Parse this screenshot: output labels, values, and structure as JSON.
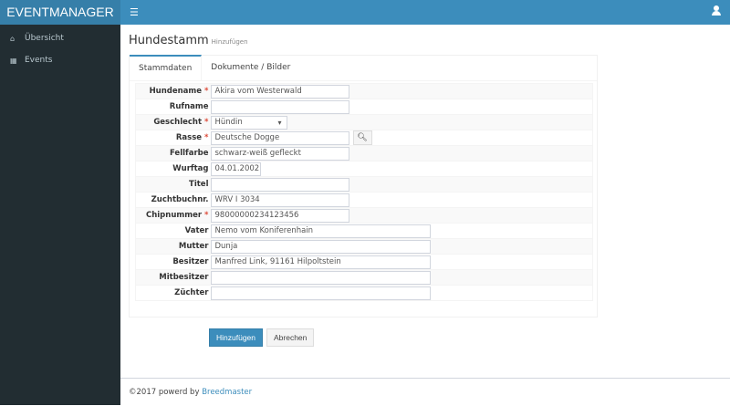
{
  "app": {
    "brand": "EVENTMANAGER",
    "menu_icon": "bars-icon",
    "user_icon": "user-icon"
  },
  "sidebar": {
    "items": [
      {
        "label": "Übersicht",
        "icon": "home-icon"
      },
      {
        "label": "Events",
        "icon": "calendar-icon"
      }
    ]
  },
  "page": {
    "title": "Hundestamm",
    "subtitle": "Hinzufügen"
  },
  "tabs": [
    {
      "label": "Stammdaten",
      "active": true
    },
    {
      "label": "Dokumente / Bilder",
      "active": false
    }
  ],
  "form": {
    "fields": [
      {
        "label": "Hundename",
        "required": true,
        "value": "Akira vom Westerwald"
      },
      {
        "label": "Rufname",
        "required": false,
        "value": ""
      },
      {
        "label": "Geschlecht",
        "required": true,
        "value": "Hündin",
        "type": "select"
      },
      {
        "label": "Rasse",
        "required": true,
        "value": "Deutsche Dogge"
      },
      {
        "label": "Fellfarbe",
        "required": false,
        "value": "schwarz-weiß gefleckt"
      },
      {
        "label": "Wurftag",
        "required": false,
        "value": "04.01.2002"
      },
      {
        "label": "Titel",
        "required": false,
        "value": ""
      },
      {
        "label": "Zuchtbuchnr.",
        "required": false,
        "value": "WRV I 3034"
      },
      {
        "label": "Chipnummer",
        "required": true,
        "value": "98000000234123456"
      },
      {
        "label": "Vater",
        "required": false,
        "value": "Nemo vom Koniferenhain"
      },
      {
        "label": "Mutter",
        "required": false,
        "value": "Dunja"
      },
      {
        "label": "Besitzer",
        "required": false,
        "value": "Manfred Link, 91161 Hilpoltstein"
      },
      {
        "label": "Mitbesitzer",
        "required": false,
        "value": ""
      },
      {
        "label": "Züchter",
        "required": false,
        "value": ""
      }
    ],
    "required_mark": "*",
    "submit_label": "Hinzufügen",
    "cancel_label": "Abrechen"
  },
  "footer": {
    "text": "©2017 powerd by ",
    "link": "Breedmaster"
  }
}
